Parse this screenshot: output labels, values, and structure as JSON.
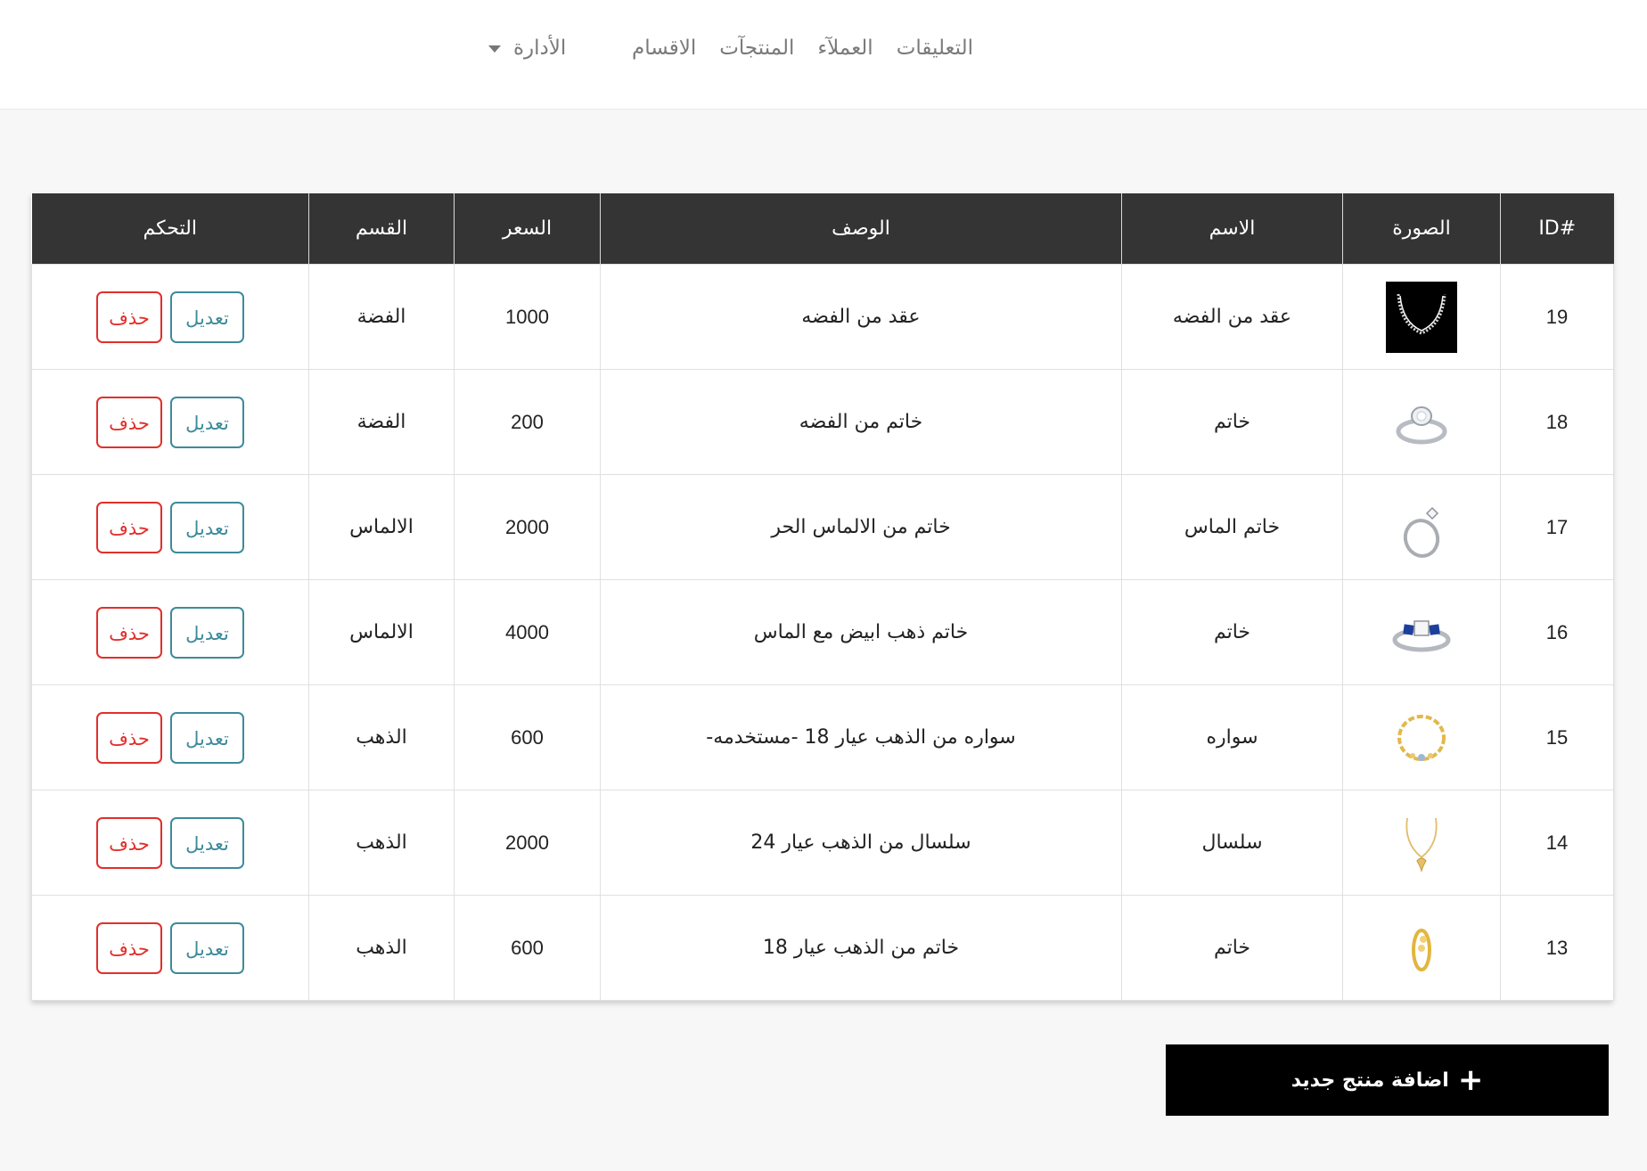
{
  "nav": {
    "links": [
      "الاقسام",
      "المنتجآت",
      "العملآء",
      "التعليقات"
    ],
    "admin_label": "الأدارة"
  },
  "table": {
    "headers": {
      "id": "ID#",
      "image": "الصورة",
      "name": "الاسم",
      "description": "الوصف",
      "price": "السعر",
      "category": "القسم",
      "control": "التحكم"
    },
    "edit_label": "تعديل",
    "delete_label": "حذف",
    "rows": [
      {
        "id": "19",
        "image_icon": "silver-necklace",
        "name": "عقد من الفضه",
        "description": "عقد من الفضه",
        "price": "1000",
        "category": "الفضة"
      },
      {
        "id": "18",
        "image_icon": "silver-ring",
        "name": "خاتم",
        "description": "خاتم من الفضه",
        "price": "200",
        "category": "الفضة"
      },
      {
        "id": "17",
        "image_icon": "diamond-solitaire-ring",
        "name": "خاتم الماس",
        "description": "خاتم من الالماس الحر",
        "price": "2000",
        "category": "الالماس"
      },
      {
        "id": "16",
        "image_icon": "sapphire-diamond-ring",
        "name": "خاتم",
        "description": "خاتم ذهب ابيض مع الماس",
        "price": "4000",
        "category": "الالماس"
      },
      {
        "id": "15",
        "image_icon": "gold-bracelet",
        "name": "سواره",
        "description": "سواره من الذهب عيار 18 -مستخدمه-",
        "price": "600",
        "category": "الذهب"
      },
      {
        "id": "14",
        "image_icon": "gold-chain-pendant",
        "name": "سلسال",
        "description": "سلسال من الذهب عيار 24",
        "price": "2000",
        "category": "الذهب"
      },
      {
        "id": "13",
        "image_icon": "gold-ring",
        "name": "خاتم",
        "description": "خاتم من الذهب عيار 18",
        "price": "600",
        "category": "الذهب"
      }
    ]
  },
  "add_button": {
    "label": "اضافة منتج جديد",
    "icon": "plus-icon"
  },
  "colors": {
    "header_bg": "#343434",
    "edit": "#3c8b9b",
    "delete": "#e0302b",
    "add_bg": "#000000"
  }
}
